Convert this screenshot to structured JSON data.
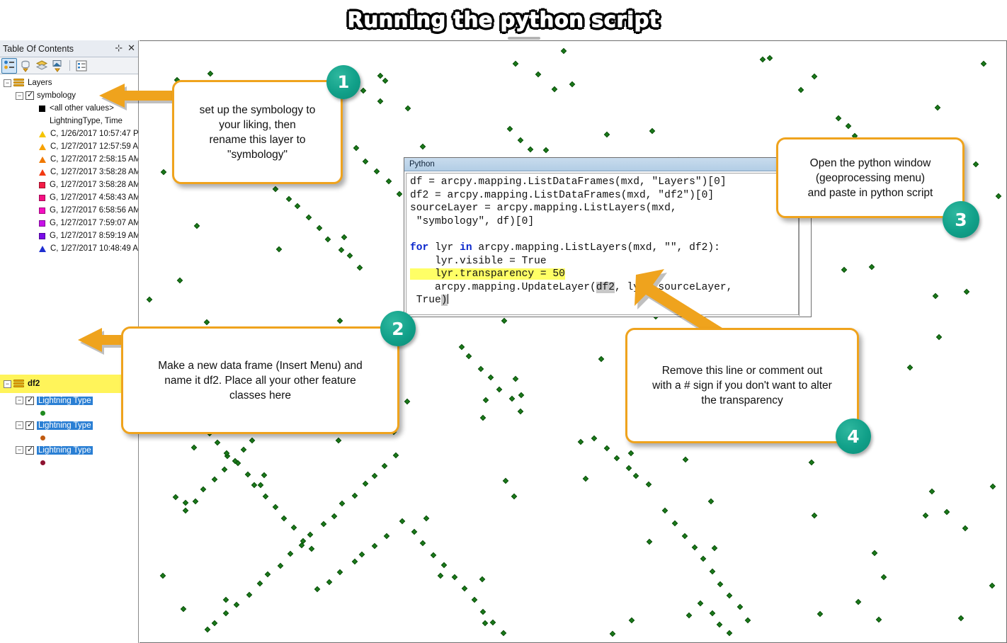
{
  "title": "Running the python script",
  "toc": {
    "panel_title": "Table Of Contents",
    "pin_icon": "pin-icon",
    "close_icon": "close-icon",
    "toolbar": [
      {
        "name": "list-by-drawing-order",
        "selected": true
      },
      {
        "name": "list-by-source",
        "selected": false
      },
      {
        "name": "list-by-visibility",
        "selected": false
      },
      {
        "name": "list-by-selection",
        "selected": false
      },
      {
        "name": "options",
        "selected": false
      }
    ],
    "layers_group": "Layers",
    "symbology_layer": "symbology",
    "legend": {
      "all_other_values": "<all other values>",
      "field_heading": "LightningType, Time",
      "classes": [
        {
          "label": "C, 1/26/2017 10:57:47 P",
          "shape": "triangle",
          "color": "#f5c400"
        },
        {
          "label": "C, 1/27/2017 12:57:59 A",
          "shape": "triangle",
          "color": "#f7a100"
        },
        {
          "label": "C, 1/27/2017 2:58:15 AM",
          "shape": "triangle",
          "color": "#f07800"
        },
        {
          "label": "C, 1/27/2017 3:58:28 AM",
          "shape": "triangle",
          "color": "#f23a12"
        },
        {
          "label": "G, 1/27/2017 3:58:28 AM",
          "shape": "square",
          "color": "#f41c46"
        },
        {
          "label": "G, 1/27/2017 4:58:43 AM",
          "shape": "square",
          "color": "#f50f82"
        },
        {
          "label": "G, 1/27/2017 6:58:56 AM",
          "shape": "square",
          "color": "#f50fc0"
        },
        {
          "label": "G, 1/27/2017 7:59:07 AM",
          "shape": "square",
          "color": "#c712e8"
        },
        {
          "label": "G, 1/27/2017 8:59:19 AM",
          "shape": "square",
          "color": "#7a0ce8"
        },
        {
          "label": "C, 1/27/2017 10:48:49 A",
          "shape": "triangle",
          "color": "#1f2fd0"
        }
      ]
    },
    "df2_group": "df2",
    "df2_layers": [
      {
        "label": "Lightning Type",
        "dot_color": "#1f8b1f"
      },
      {
        "label": "Lightning Type",
        "dot_color": "#c05a10"
      },
      {
        "label": "Lightning Type",
        "dot_color": "#8e1230"
      }
    ]
  },
  "python_window": {
    "title": "Python",
    "code_lines": [
      "df = arcpy.mapping.ListDataFrames(mxd, \"Layers\")[0]",
      "df2 = arcpy.mapping.ListDataFrames(mxd, \"df2\")[0]",
      "sourceLayer = arcpy.mapping.ListLayers(mxd,",
      " \"symbology\", df)[0]",
      "",
      "for lyr in arcpy.mapping.ListLayers(mxd, \"\", df2):",
      "    lyr.visible = True",
      "    lyr.transparency = 50",
      "    arcpy.mapping.UpdateLayer(df2, lyr, sourceLayer,",
      " True)"
    ],
    "highlighted_line": "    lyr.transparency = 50",
    "keywords": [
      "for",
      "in"
    ],
    "scroll_down_icon": "chevron-down-icon"
  },
  "callouts": [
    {
      "number": "1",
      "text": "set up the symbology to\nyour liking, then\nrename this layer to\n\"symbology\"",
      "badge_position": "top-right"
    },
    {
      "number": "2",
      "text": "Make a new data frame (Insert Menu) and\nname it df2. Place all your other feature\nclasses here",
      "badge_position": "top-right"
    },
    {
      "number": "3",
      "text": "Open the python window\n(geoprocessing menu)\nand paste in python script",
      "badge_position": "bottom-right"
    },
    {
      "number": "4",
      "text": "Remove this line or comment out\nwith a # sign if you don't want to alter\nthe transparency",
      "badge_position": "bottom-right"
    }
  ],
  "colors": {
    "accent_orange": "#efa31d",
    "badge_teal": "#11a089",
    "highlight_yellow": "#ffff66",
    "selection_blue": "#2a7fd4",
    "map_point_green": "#1a7a1a",
    "df2_band_yellow": "#fff45a"
  },
  "map": {
    "point_symbol": "green-diamond",
    "point_count": 255
  }
}
